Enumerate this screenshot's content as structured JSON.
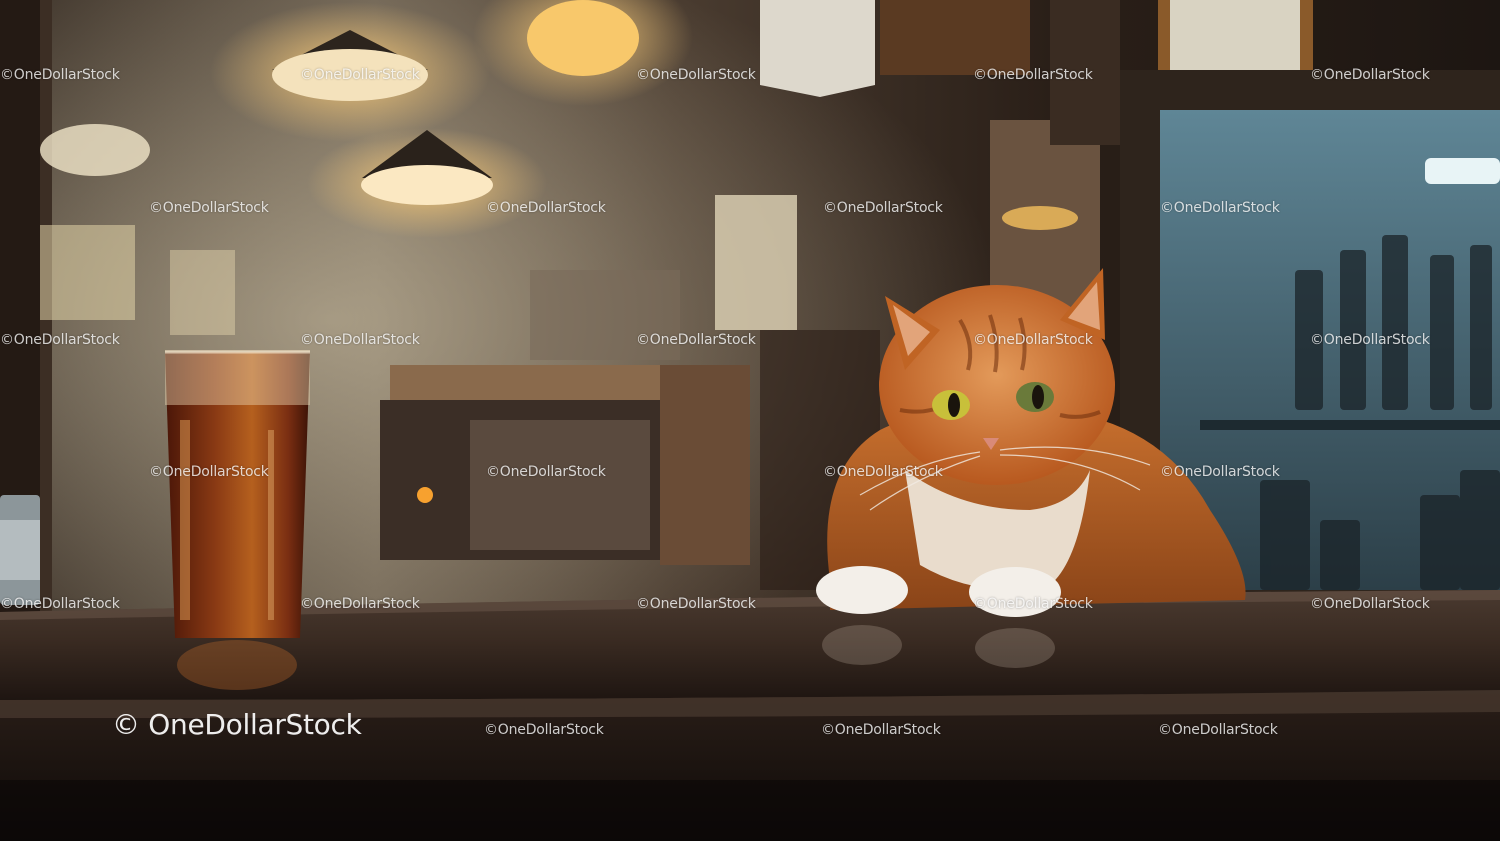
{
  "image": {
    "subject": "cat at bar"
  },
  "watermark": {
    "small_text": "©OneDollarStock",
    "large_text": "© OneDollarStock"
  },
  "colors": {
    "counter": "#3a2a22",
    "beer": "#7a2e12",
    "cat_fur": "#c2642a",
    "lamp_glow": "#f7c978"
  }
}
